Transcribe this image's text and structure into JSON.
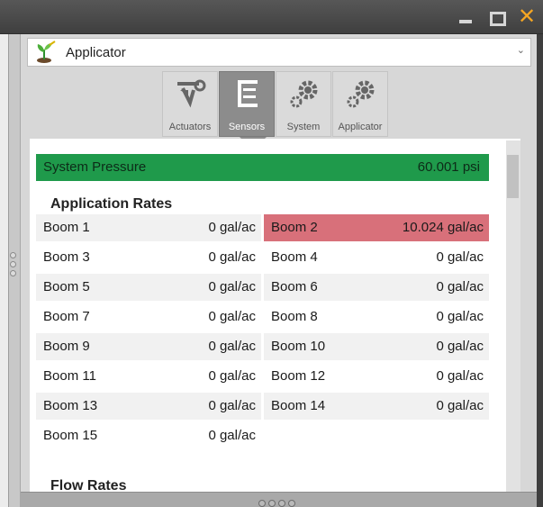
{
  "window": {
    "controls": {
      "minimize_icon": "minimize-icon",
      "maximize_icon": "maximize-icon",
      "close_icon": "close-icon",
      "close_glyph": "✕"
    }
  },
  "app_selector": {
    "selected": "Applicator",
    "icon": "sprayer-icon"
  },
  "tabs": [
    {
      "label": "Actuators",
      "icon": "actuator-icon",
      "active": false
    },
    {
      "label": "Sensors",
      "icon": "sensor-bars-icon",
      "active": true
    },
    {
      "label": "System",
      "icon": "gears-icon",
      "active": false
    },
    {
      "label": "Applicator",
      "icon": "gears-icon",
      "active": false
    }
  ],
  "system_pressure": {
    "label": "System Pressure",
    "value": "60.001",
    "unit": "psi"
  },
  "application_rates": {
    "title": "Application Rates",
    "unit": "gal/ac",
    "booms": [
      {
        "name": "Boom 1",
        "value": "0"
      },
      {
        "name": "Boom 2",
        "value": "10.024",
        "alert": true
      },
      {
        "name": "Boom 3",
        "value": "0"
      },
      {
        "name": "Boom 4",
        "value": "0"
      },
      {
        "name": "Boom 5",
        "value": "0"
      },
      {
        "name": "Boom 6",
        "value": "0"
      },
      {
        "name": "Boom 7",
        "value": "0"
      },
      {
        "name": "Boom 8",
        "value": "0"
      },
      {
        "name": "Boom 9",
        "value": "0"
      },
      {
        "name": "Boom 10",
        "value": "0"
      },
      {
        "name": "Boom 11",
        "value": "0"
      },
      {
        "name": "Boom 12",
        "value": "0"
      },
      {
        "name": "Boom 13",
        "value": "0"
      },
      {
        "name": "Boom 14",
        "value": "0"
      },
      {
        "name": "Boom 15",
        "value": "0"
      }
    ]
  },
  "flow_rates": {
    "title": "Flow Rates"
  },
  "colors": {
    "pressure_ok": "#1f9a4b",
    "rate_alert": "#d8707a",
    "close_accent": "#f5a623",
    "active_tab": "#8c8c8c"
  }
}
